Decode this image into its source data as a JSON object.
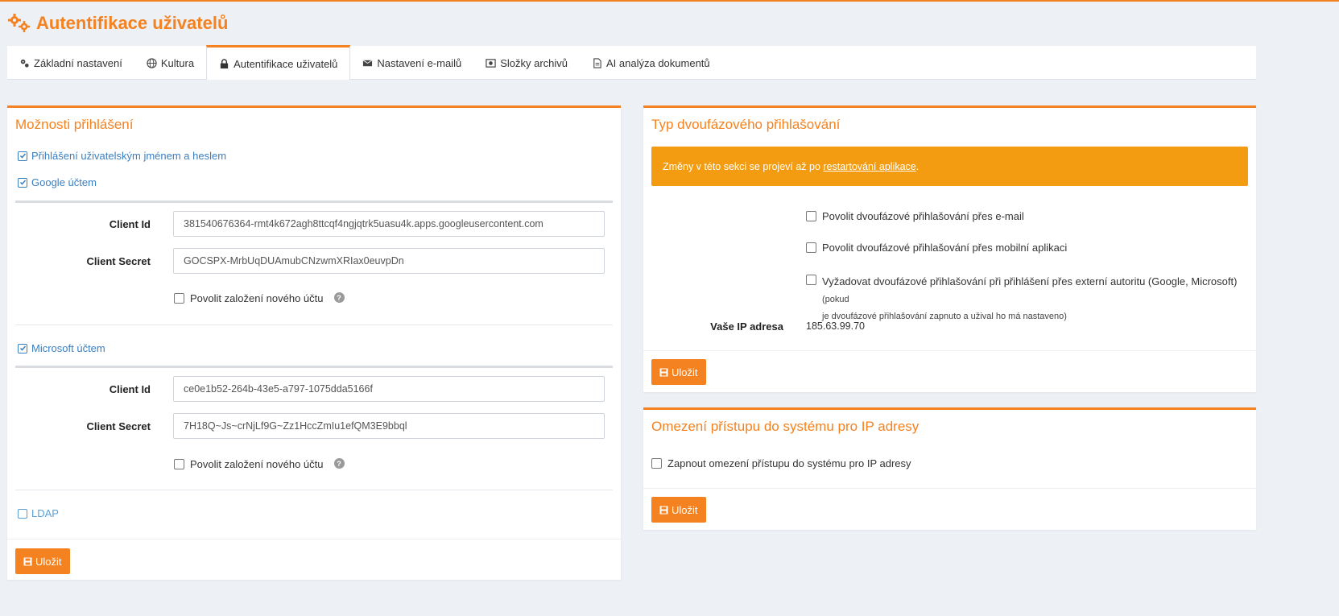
{
  "page": {
    "title": "Autentifikace uživatelů"
  },
  "tabs": [
    {
      "label": "Základní nastavení",
      "icon": "gears-icon"
    },
    {
      "label": "Kultura",
      "icon": "globe-icon"
    },
    {
      "label": "Autentifikace uživatelů",
      "icon": "lock-icon"
    },
    {
      "label": "Nastavení e-mailů",
      "icon": "envelope-icon"
    },
    {
      "label": "Složky archivů",
      "icon": "archive-folder-icon"
    },
    {
      "label": "AI analýza dokumentů",
      "icon": "document-icon"
    }
  ],
  "login_options": {
    "title": "Možnosti přihlášení",
    "username_password": {
      "label": "Přihlášení uživatelským jménem a heslem",
      "checked": true
    },
    "google": {
      "label": "Google účtem",
      "checked": true,
      "client_id_label": "Client Id",
      "client_id": "381540676364-rmt4k672agh8ttcqf4ngjqtrk5uasu4k.apps.googleusercontent.com",
      "client_secret_label": "Client Secret",
      "client_secret": "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",
      "allow_new_account": "Povolit založení nového účtu"
    },
    "microsoft": {
      "label": "Microsoft účtem",
      "checked": true,
      "client_id_label": "Client Id",
      "client_id": "ce0e1b52-264b-43e5-a797-1075dda5166f",
      "client_secret_label": "Client Secret",
      "client_secret": "7H18Q~Js~crNjLf9G~Zz1HccZmIu1efQM3E9bbql",
      "allow_new_account": "Povolit založení nového účtu"
    },
    "ldap": {
      "label": "LDAP",
      "checked": false
    },
    "save_label": "Uložit"
  },
  "two_factor": {
    "title": "Typ dvoufázového přihlašování",
    "alert_prefix": "Změny v této sekci se projeví až po ",
    "alert_link": "restartování aplikace",
    "alert_suffix": ".",
    "opt_email": "Povolit dvoufázové přihlašování přes e-mail",
    "opt_mobile": "Povolit dvoufázové přihlašování přes mobilní aplikaci",
    "opt_external": "Vyžadovat dvoufázové přihlašování při přihlášení přes externí autoritu (Google, Microsoft)",
    "opt_external_note_a": " (pokud",
    "opt_external_note_b": "je dvoufázové přihlašování zapnuto a užival ho má nastaveno)",
    "ip_label": "Vaše IP adresa",
    "ip_value": "185.63.99.70",
    "save_label": "Uložit"
  },
  "ip_restriction": {
    "title": "Omezení přístupu do systému pro IP adresy",
    "enable_label": "Zapnout omezení přístupu do systému pro IP adresy",
    "save_label": "Uložit"
  },
  "colors": {
    "accent": "#f58220",
    "link": "#3a7fc1",
    "alert": "#f39c12",
    "background": "#edf0f4"
  }
}
